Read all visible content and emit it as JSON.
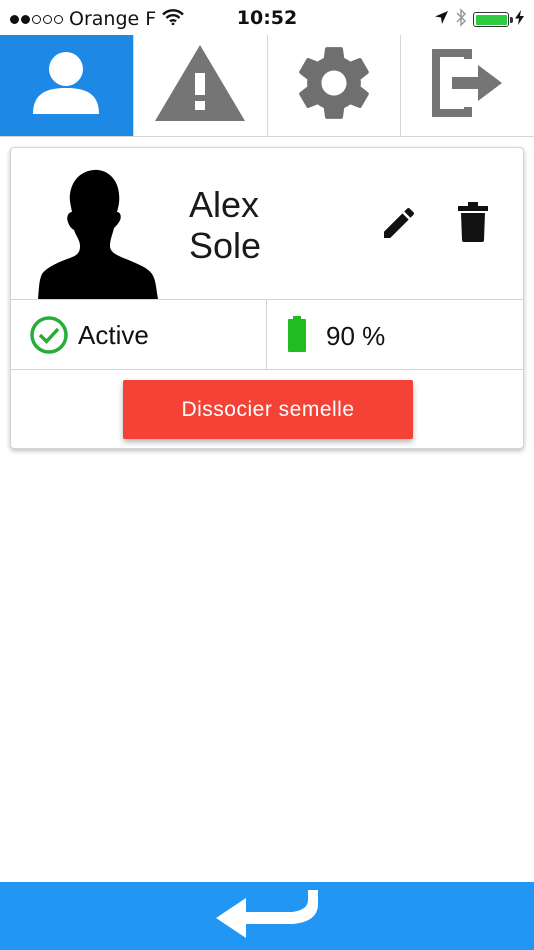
{
  "status_bar": {
    "signal_dots": [
      "full",
      "full",
      "empty",
      "empty",
      "empty"
    ],
    "carrier": "Orange F",
    "time": "10:52",
    "battery_level": 1.0,
    "battery_color": "#2ecc40"
  },
  "tabs": [
    {
      "name": "profile",
      "icon": "person-icon",
      "active": true
    },
    {
      "name": "alerts",
      "icon": "warning-icon",
      "active": false
    },
    {
      "name": "settings",
      "icon": "gear-icon",
      "active": false
    },
    {
      "name": "logout",
      "icon": "logout-icon",
      "active": false
    }
  ],
  "user": {
    "first_name": "Alex",
    "last_name": "Sole",
    "status": "Active",
    "battery": "90 %"
  },
  "actions": {
    "dissociate_label": "Dissocier semelle"
  },
  "colors": {
    "accent": "#1e88e5",
    "danger": "#f44336",
    "success": "#27ae3a",
    "bottom_bar": "#2196f3"
  }
}
